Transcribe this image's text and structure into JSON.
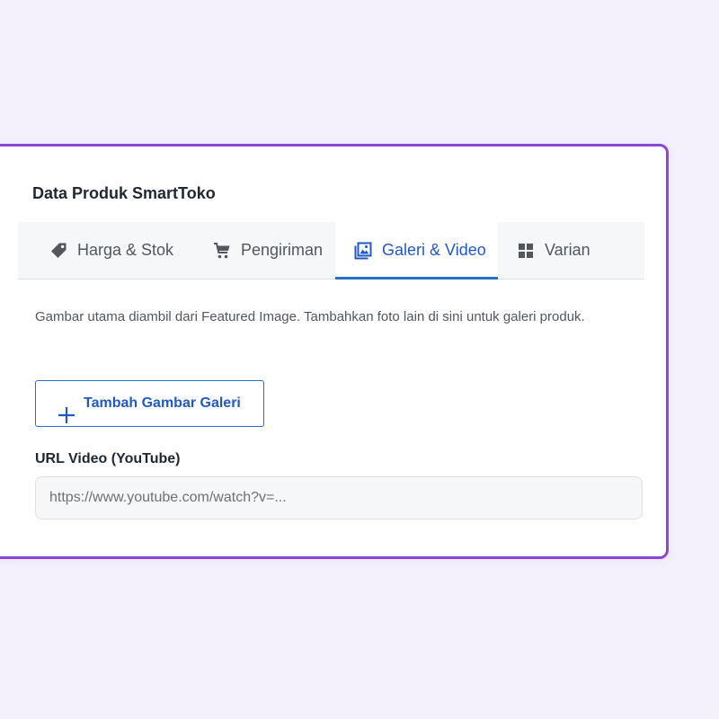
{
  "panel": {
    "title": "Data Produk SmartToko"
  },
  "tabs": [
    {
      "label": "Harga & Stok",
      "icon": "tag-icon",
      "active": false
    },
    {
      "label": "Pengiriman",
      "icon": "cart-icon",
      "active": false
    },
    {
      "label": "Galeri & Video",
      "icon": "image-gallery-icon",
      "active": true
    },
    {
      "label": "Varian",
      "icon": "grid-icon",
      "active": false
    }
  ],
  "gallery": {
    "description": "Gambar utama diambil dari Featured Image. Tambahkan foto lain di sini untuk galeri produk.",
    "add_button_label": "Tambah Gambar Galeri",
    "video_label": "URL Video (YouTube)",
    "video_placeholder": "https://www.youtube.com/watch?v=...",
    "video_value": ""
  },
  "colors": {
    "background": "#f4f1fd",
    "panel_border": "#8b46d8",
    "accent": "#2271d1",
    "active_tab_text": "#2059c7",
    "text_muted": "#50575e",
    "text_dark": "#1f2733"
  }
}
